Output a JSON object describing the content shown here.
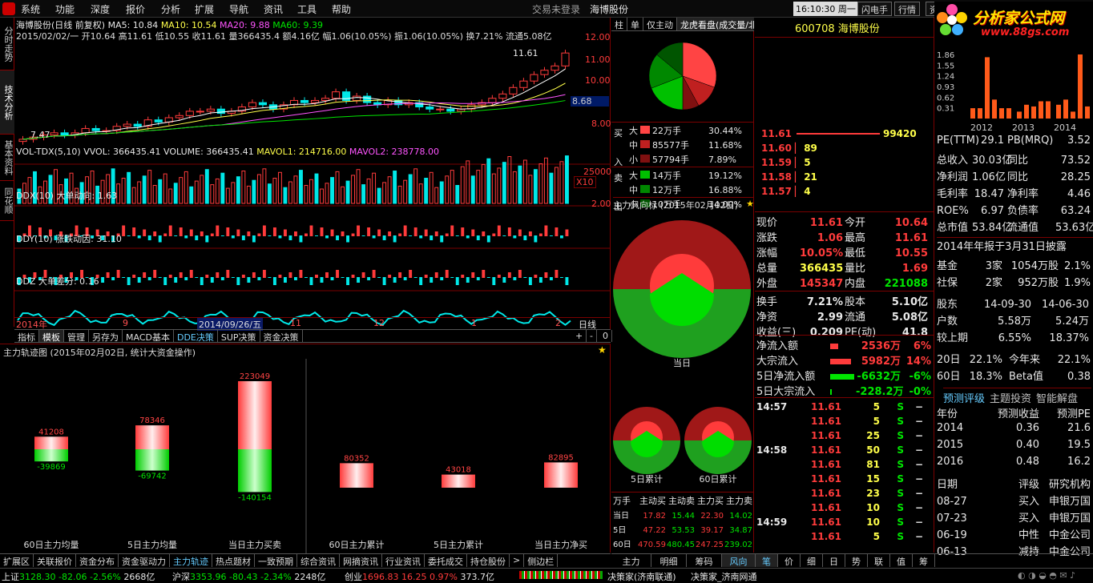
{
  "menu": {
    "items": [
      "系统",
      "功能",
      "深度",
      "报价",
      "分析",
      "扩展",
      "导航",
      "资讯",
      "工具",
      "帮助"
    ],
    "trade_status": "交易未登录",
    "stock_title": "海博股份",
    "clock": "16:10:30 周一",
    "buttons": [
      "闪电手",
      "行情",
      "资讯"
    ]
  },
  "brand": {
    "name": "分析家公式网",
    "url": "www.88gs.com"
  },
  "vtabs": [
    "分时走势",
    "技术分析",
    "基本资料",
    "同花顺"
  ],
  "kline": {
    "title": "海博股份(日线 前复权)",
    "ma5": "MA5: 10.84",
    "ma10": "MA10: 10.54",
    "ma20": "MA20: 9.88",
    "ma60": "MA60: 9.39",
    "info": "2015/02/02/一 开10.64 高11.61 低10.55 收11.61 量366435.4 额4.16亿 幅1.06(10.05%) 振1.06(10.05%) 换7.21% 流通5.08亿",
    "price_ticks": [
      "12.00",
      "11.00",
      "10.00",
      "8.68",
      "8.00"
    ],
    "low_label": "7.47",
    "high_label": "11.61",
    "closes": [
      7.6,
      7.7,
      7.8,
      7.9,
      7.8,
      7.9,
      8.1,
      8.0,
      8.0,
      8.2,
      8.3,
      8.2,
      8.5,
      8.4,
      8.6,
      8.7,
      8.9,
      8.9,
      9.0,
      8.8,
      8.9,
      9.1,
      9.3,
      9.2,
      9.0,
      9.2,
      9.4,
      9.3,
      9.4,
      9.5,
      9.8,
      9.4,
      9.6,
      9.3,
      9.2,
      9.4,
      9.2,
      9.3,
      9.1,
      9.0,
      9.0,
      8.9,
      9.0,
      9.2,
      9.3,
      9.5,
      9.7,
      10.0,
      10.3,
      10.6,
      10.8,
      11.0,
      11.6
    ]
  },
  "vol": {
    "title": "VOL-TDX(5,10)",
    "vvol": "VVOL: 366435.41",
    "volume": "VOLUME: 366435.41",
    "mavol1": "MAVOL1: 214716.00",
    "mavol2": "MAVOL2: 238778.00",
    "tick": "25000",
    "mult": "X10"
  },
  "ddx": {
    "title": "DDX(10)",
    "label": "大单动向: 1.63",
    "tick": "2.00"
  },
  "ddy": {
    "title": "DDY(10)",
    "label": "涨跌动因: 31.10"
  },
  "ddz": {
    "title": "DDZ",
    "label": "大单差分: 0.16"
  },
  "axis": {
    "labels": [
      "2014年",
      "9",
      "2014/09/26/五",
      "11",
      "12",
      "1",
      "2"
    ],
    "period": "日线"
  },
  "bottom_tabs": [
    "指标",
    "模板",
    "管理",
    "另存为",
    "MACD基本",
    "DDE决策",
    "SUP决策",
    "资金决策"
  ],
  "track": {
    "title": "主力轨迹图 (2015年02月02日, 统计大资金操作)",
    "bars": [
      {
        "label": "60日主力均量",
        "up": "41208",
        "down": "-39869",
        "upv": 41208,
        "downv": 39869
      },
      {
        "label": "5日主力均量",
        "up": "78346",
        "down": "-69742",
        "upv": 78346,
        "downv": 69742
      },
      {
        "label": "当日主力买卖",
        "up": "223049",
        "down": "-140154",
        "upv": 223049,
        "downv": 140154
      },
      {
        "label": "60日主力累计",
        "up": "80352",
        "upv": 80352
      },
      {
        "label": "5日主力累计",
        "up": "43018",
        "upv": 43018
      },
      {
        "label": "当日主力净买",
        "up": "82895",
        "upv": 82895
      }
    ]
  },
  "midtabs": [
    "柱",
    "单",
    "仅主动",
    "龙虎看盘(成交量/北"
  ],
  "orders": {
    "buy_label": [
      "买",
      "入"
    ],
    "sell_label": [
      "卖",
      "出"
    ],
    "buy": [
      {
        "sz": "大",
        "v": "22万手",
        "p": "30.44%",
        "c": "#ff4444"
      },
      {
        "sz": "中",
        "v": "85577手",
        "p": "11.68%",
        "c": "#c02020"
      },
      {
        "sz": "小",
        "v": "57794手",
        "p": "7.89%",
        "c": "#801010"
      }
    ],
    "sell": [
      {
        "sz": "大",
        "v": "14万手",
        "p": "19.12%",
        "c": "#00c000"
      },
      {
        "sz": "中",
        "v": "12万手",
        "p": "16.88%",
        "c": "#008800"
      },
      {
        "sz": "小",
        "v": "10万手",
        "p": "14.00%",
        "c": "#005500"
      }
    ]
  },
  "pie_slices": [
    30.44,
    11.68,
    7.89,
    19.12,
    16.88,
    14.0
  ],
  "fengxiang": {
    "title": "主力风向标 (2015年02月02日)",
    "today": "当日",
    "d5": "5日累计",
    "d60": "60日累计"
  },
  "flow_table": {
    "headers": [
      "万手",
      "主动买",
      "主动卖",
      "主力买",
      "主力卖"
    ],
    "rows": [
      [
        "当日",
        "17.82",
        "15.44",
        "22.30",
        "14.02"
      ],
      [
        "5日",
        "47.22",
        "53.53",
        "39.17",
        "34.87"
      ],
      [
        "60日",
        "470.59",
        "480.45",
        "247.25",
        "239.02"
      ]
    ]
  },
  "stock": {
    "code": "600708",
    "name": "海博股份"
  },
  "depth": [
    {
      "p": "11.61",
      "v": "99420"
    },
    {
      "p": "11.60",
      "v": "89"
    },
    {
      "p": "11.59",
      "v": "5"
    },
    {
      "p": "11.58",
      "v": "21"
    },
    {
      "p": "11.57",
      "v": "4"
    }
  ],
  "quote": [
    [
      "现价",
      "11.61",
      "今开",
      "10.64"
    ],
    [
      "涨跌",
      "1.06",
      "最高",
      "11.61"
    ],
    [
      "涨幅",
      "10.05%",
      "最低",
      "10.55"
    ],
    [
      "总量",
      "366435",
      "量比",
      "1.69"
    ],
    [
      "外盘",
      "145347",
      "内盘",
      "221088"
    ],
    [
      "换手",
      "7.21%",
      "股本",
      "5.10亿"
    ],
    [
      "净资",
      "2.99",
      "流通",
      "5.08亿"
    ],
    [
      "收益(三)",
      "0.209",
      "PE(动)",
      "41.8"
    ]
  ],
  "flow": [
    {
      "k": "净流入额",
      "v": "2536万",
      "p": "6%"
    },
    {
      "k": "大宗流入",
      "v": "5982万",
      "p": "14%"
    },
    {
      "k": "5日净流入额",
      "v": "-6632万",
      "p": "-6%"
    },
    {
      "k": "5日大宗流入",
      "v": "-228.2万",
      "p": "-0%"
    }
  ],
  "ticks": [
    {
      "t": "14:57",
      "p": "11.61",
      "v": "5",
      "s": "S"
    },
    {
      "t": "",
      "p": "11.61",
      "v": "5",
      "s": "S"
    },
    {
      "t": "",
      "p": "11.61",
      "v": "25",
      "s": "S"
    },
    {
      "t": "14:58",
      "p": "11.61",
      "v": "50",
      "s": "S"
    },
    {
      "t": "",
      "p": "11.61",
      "v": "81",
      "s": "S"
    },
    {
      "t": "",
      "p": "11.61",
      "v": "15",
      "s": "S"
    },
    {
      "t": "",
      "p": "11.61",
      "v": "23",
      "s": "S"
    },
    {
      "t": "",
      "p": "11.61",
      "v": "10",
      "s": "S"
    },
    {
      "t": "14:59",
      "p": "11.61",
      "v": "10",
      "s": "S"
    },
    {
      "t": "",
      "p": "11.61",
      "v": "5",
      "s": "S"
    }
  ],
  "right_tabs": [
    "主力",
    "明细",
    "筹码",
    "风向",
    "笔",
    "价",
    "细",
    "日",
    "势",
    "联",
    "值",
    "筹"
  ],
  "fin": {
    "years": [
      "2012",
      "2013",
      "2014"
    ],
    "bar_ticks": [
      "1.86",
      "1.55",
      "1.24",
      "0.93",
      "0.62",
      "0.31"
    ],
    "bars": [
      0.3,
      0.3,
      1.78,
      0.55,
      0.3,
      0.3,
      0.2,
      0.4,
      0.35,
      0.5,
      0.5,
      0.4,
      0.55,
      0.2,
      1.86,
      0.35
    ],
    "rows": [
      [
        "PE(TTM)",
        "29.1",
        "PB(MRQ)",
        "3.52"
      ],
      [
        "总收入",
        "30.03亿",
        "同比",
        "73.52"
      ],
      [
        "净利润",
        "1.06亿",
        "同比",
        "28.25"
      ],
      [
        "毛利率",
        "18.47",
        "净利率",
        "4.46"
      ],
      [
        "ROE%",
        "6.97",
        "负债率",
        "63.24"
      ],
      [
        "总市值",
        "53.84亿",
        "流通值",
        "53.63亿"
      ]
    ],
    "report": "2014年年报于3月31日披露",
    "holders": [
      [
        "基金",
        "3家",
        "1054万股",
        "2.1%"
      ],
      [
        "社保",
        "2家",
        "952万股",
        "1.9%"
      ]
    ],
    "share": [
      [
        "股东",
        "14-09-30",
        "14-06-30"
      ],
      [
        "户数",
        "5.58万",
        "5.24万"
      ],
      [
        "较上期",
        "6.55%",
        "18.37%"
      ]
    ],
    "chg": [
      [
        "20日",
        "22.1%",
        "今年来",
        "22.1%"
      ],
      [
        "60日",
        "18.3%",
        "Beta值",
        "0.38"
      ]
    ],
    "tabs": [
      "预测评级",
      "主题投资",
      "智能解盘"
    ],
    "fc_head": [
      "年份",
      "预测收益",
      "预测PE"
    ],
    "fc": [
      [
        "2014",
        "0.36",
        "21.6"
      ],
      [
        "2015",
        "0.40",
        "19.5"
      ],
      [
        "2016",
        "0.48",
        "16.2"
      ]
    ],
    "rt_head": [
      "日期",
      "评级",
      "研究机构"
    ],
    "ratings": [
      [
        "08-27",
        "买入",
        "申银万国"
      ],
      [
        "07-23",
        "买入",
        "申银万国"
      ],
      [
        "06-19",
        "中性",
        "中金公司"
      ],
      [
        "06-13",
        "减持",
        "中金公司"
      ]
    ]
  },
  "bottom_bar": [
    "扩展区",
    "关联报价",
    "资金分布",
    "资金驱动力",
    "主力轨迹",
    "热点题材",
    "一致预期",
    "综合资讯",
    "网摘资讯",
    "行业资讯",
    "委托成交",
    "持仓股份",
    ">",
    "侧边栏"
  ],
  "status": {
    "sh": "上证",
    "sh_v": "3128.30",
    "sh_c": "-82.06",
    "sh_p": "-2.56%",
    "sh_a": "2668亿",
    "hs": "沪深",
    "hs_v": "3353.96",
    "hs_c": "-80.43",
    "hs_p": "-2.34%",
    "hs_a": "2248亿",
    "cy": "创业",
    "cy_v": "1696.83",
    "cy_c": "16.25",
    "cy_p": "0.97%",
    "cy_a": "373.7亿",
    "j1": "决策家(济南联通)",
    "j2": "决策家_济南网通"
  },
  "colors": {
    "up": "#ff3b3b",
    "down": "#00e600",
    "border": "#7a0000"
  }
}
